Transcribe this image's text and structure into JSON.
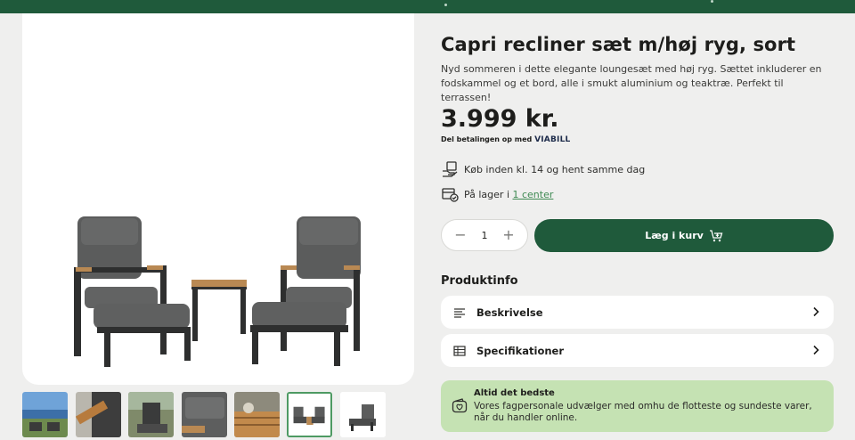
{
  "colors": {
    "brand_green": "#1f5a3b",
    "link_green": "#3f8a53",
    "promo_bg": "#c5e2b3",
    "page_bg": "#efefee"
  },
  "product": {
    "title": "Capri recliner sæt m/høj ryg, sort",
    "description": "Nyd sommeren i dette elegante loungesæt med høj ryg. Sættet inkluderer en fodskammel og et bord, alle i smukt aluminium og teaktræ. Perfekt til terrassen!",
    "price": "3.999 kr.",
    "paylater_prefix": "Del betalingen op med",
    "paylater_brand": "VIABILL"
  },
  "delivery": {
    "pickup_text": "Køb inden kl. 14 og hent samme dag",
    "pickup_icon": "hand-package-icon",
    "stock_prefix": "På lager i",
    "stock_link": "1 center",
    "stock_icon": "store-check-icon"
  },
  "cart": {
    "quantity": "1",
    "minus": "−",
    "plus": "+",
    "add_label": "Læg i kurv",
    "cart_icon": "cart-plus-icon"
  },
  "product_info": {
    "heading": "Produktinfo",
    "items": [
      {
        "label": "Beskrivelse",
        "icon": "text-lines-icon"
      },
      {
        "label": "Specifikationer",
        "icon": "table-icon"
      }
    ]
  },
  "promo": {
    "title": "Altid det bedste",
    "text": "Vores fagpersonale udvælger med omhu de flotteste og sundeste varer, når du handler online.",
    "icon": "wallet-heart-icon"
  },
  "gallery": {
    "thumbnail_count": 7,
    "selected_index": 5
  }
}
